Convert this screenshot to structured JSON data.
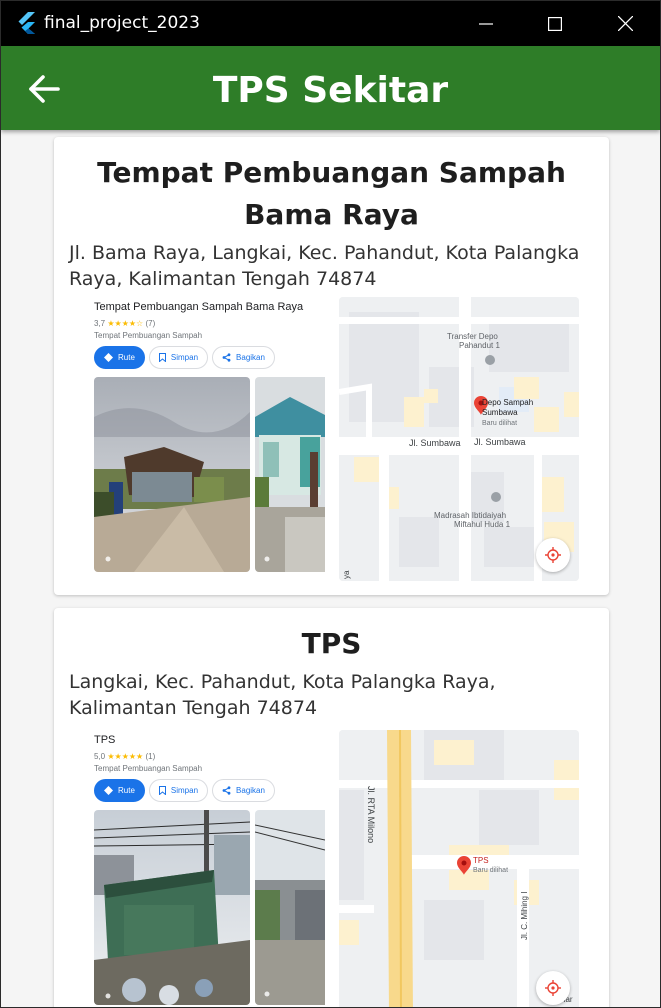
{
  "window": {
    "title": "final_project_2023",
    "controls": {
      "minimize": "minimize-icon",
      "maximize": "maximize-icon",
      "close": "close-icon"
    }
  },
  "appbar": {
    "title": "TPS Sekitar",
    "back_icon": "arrow-left-icon",
    "color": "#2e7d28"
  },
  "places": [
    {
      "name": "Tempat Pembuangan Sampah Bama Raya",
      "address": "Jl. Bama Raya, Langkai, Kec. Pahandut, Kota Palangka Raya, Kalimantan Tengah 74874",
      "preview": {
        "name": "Tempat Pembuangan Sampah Bama Raya",
        "rating": "3,7",
        "stars": "★★★★☆",
        "reviews": "(7)",
        "type": "Tempat Pembuangan Sampah",
        "actions": [
          "Rute",
          "Simpan",
          "Bagikan"
        ],
        "map_labels": {
          "poi1": "Transfer Depo",
          "poi1b": "Pahandut 1",
          "pin": "Depo Sampah",
          "pin_b": "Sumbawa",
          "pin_c": "Baru dilihat",
          "street1": "Jl. Sumbawa",
          "street2": "Jl. Sumbawa",
          "poi2": "Madrasah Ibtidaiyah",
          "poi2b": "Miftahul Huda 1",
          "edge": "ya"
        }
      }
    },
    {
      "name": "TPS",
      "address": "Langkai, Kec. Pahandut, Kota Palangka Raya, Kalimantan Tengah 74874",
      "preview": {
        "name": "TPS",
        "rating": "5,0",
        "stars": "★★★★★",
        "reviews": "(1)",
        "type": "Tempat Pembuangan Sampah",
        "actions": [
          "Rute",
          "Simpan",
          "Bagikan"
        ],
        "map_labels": {
          "road": "Jl. RTA Milono",
          "pin": "TPS",
          "pin_b": "Baru dilihat",
          "street": "Jl. C. Mihing I",
          "edge": "nar"
        }
      }
    }
  ]
}
